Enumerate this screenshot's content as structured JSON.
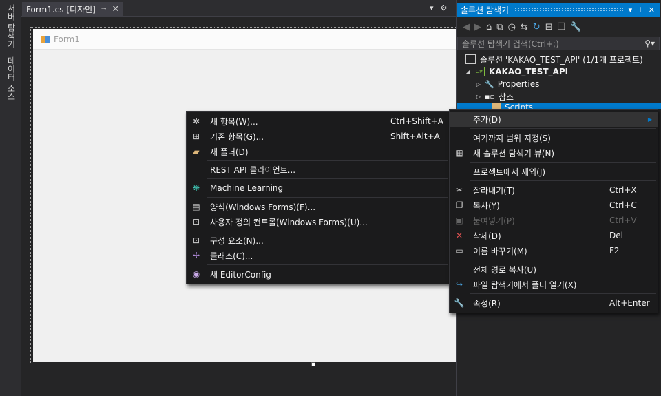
{
  "left_tabs": [
    "서버 탐색기",
    "데이터 소스"
  ],
  "document_tab": {
    "title": "Form1.cs [디자인]",
    "pin": "⊸",
    "close": "✕"
  },
  "form": {
    "title": "Form1"
  },
  "solution_explorer": {
    "title": "솔루션 탐색기",
    "search_placeholder": "솔루션 탐색기 검색(Ctrl+;)",
    "tree": [
      {
        "label": "솔루션 'KAKAO_TEST_API' (1/1개 프로젝트)"
      },
      {
        "label": "KAKAO_TEST_API"
      },
      {
        "label": "Properties"
      },
      {
        "label": "참조"
      },
      {
        "label": "Scripts"
      }
    ]
  },
  "add_submenu": {
    "items": [
      {
        "label": "새 항목(W)...",
        "shortcut": "Ctrl+Shift+A",
        "icon": "new-item-icon"
      },
      {
        "label": "기존 항목(G)...",
        "shortcut": "Shift+Alt+A",
        "icon": "existing-item-icon"
      },
      {
        "label": "새 폴더(D)",
        "shortcut": "",
        "icon": "new-folder-icon"
      },
      {
        "label": "REST API 클라이언트...",
        "shortcut": "",
        "icon": ""
      },
      {
        "label": "Machine Learning",
        "shortcut": "",
        "icon": "machine-learning-icon"
      },
      {
        "label": "양식(Windows Forms)(F)...",
        "shortcut": "",
        "icon": "form-icon"
      },
      {
        "label": "사용자 정의 컨트롤(Windows Forms)(U)...",
        "shortcut": "",
        "icon": "user-control-icon"
      },
      {
        "label": "구성 요소(N)...",
        "shortcut": "",
        "icon": "component-icon"
      },
      {
        "label": "클래스(C)...",
        "shortcut": "",
        "icon": "class-icon"
      },
      {
        "label": "새 EditorConfig",
        "shortcut": "",
        "icon": "editorconfig-icon"
      }
    ]
  },
  "context_menu": {
    "items": [
      {
        "label": "추가(D)",
        "shortcut": ""
      },
      {
        "label": "여기까지 범위 지정(S)",
        "shortcut": ""
      },
      {
        "label": "새 솔루션 탐색기 뷰(N)",
        "shortcut": ""
      },
      {
        "label": "프로젝트에서 제외(J)",
        "shortcut": ""
      },
      {
        "label": "잘라내기(T)",
        "shortcut": "Ctrl+X"
      },
      {
        "label": "복사(Y)",
        "shortcut": "Ctrl+C"
      },
      {
        "label": "붙여넣기(P)",
        "shortcut": "Ctrl+V"
      },
      {
        "label": "삭제(D)",
        "shortcut": "Del"
      },
      {
        "label": "이름 바꾸기(M)",
        "shortcut": "F2"
      },
      {
        "label": "전체 경로 복사(U)",
        "shortcut": ""
      },
      {
        "label": "파일 탐색기에서 폴더 열기(X)",
        "shortcut": ""
      },
      {
        "label": "속성(R)",
        "shortcut": "Alt+Enter"
      }
    ]
  },
  "colors": {
    "accent": "#007acc",
    "menu_bg": "#1b1b1c",
    "ide_bg": "#2d2d30",
    "delete_icon": "#e05252",
    "folder": "#dcb67a"
  }
}
